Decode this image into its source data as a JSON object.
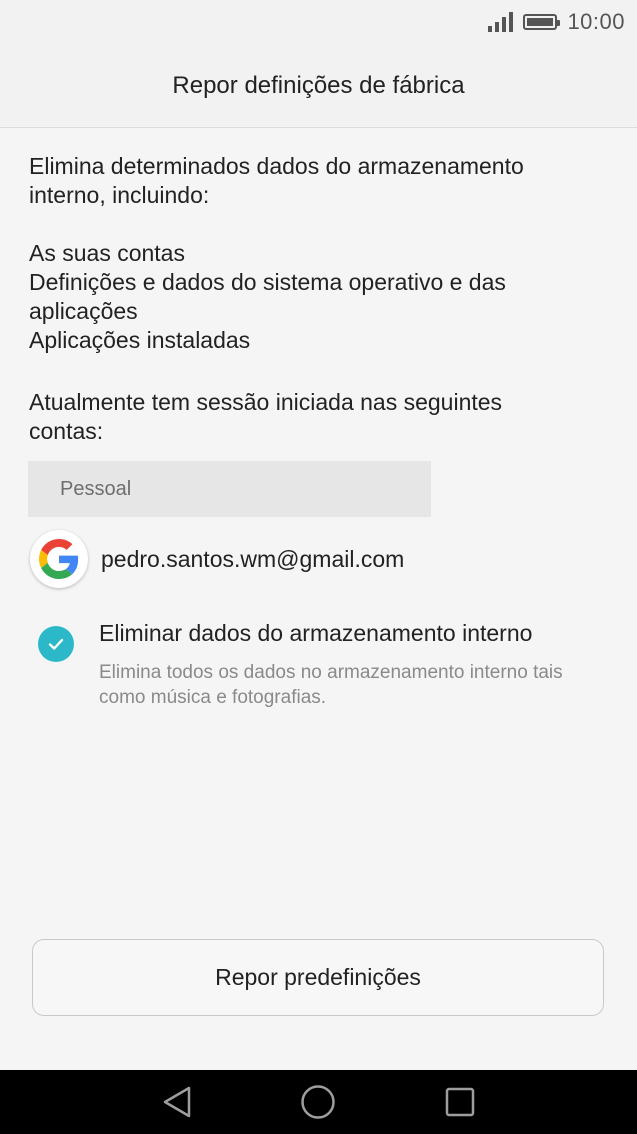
{
  "status_bar": {
    "time": "10:00",
    "icons": [
      "signal-icon",
      "battery-icon"
    ]
  },
  "header": {
    "title": "Repor definições de fábrica"
  },
  "content": {
    "intro_line1": "Elimina determinados dados do armazenamento",
    "intro_line2": "interno, incluindo:",
    "items": [
      "As suas contas",
      "Definições e dados do sistema operativo e das",
      "aplicações",
      "Aplicações instaladas"
    ],
    "accounts_line1": "Atualmente tem sessão iniciada nas seguintes",
    "accounts_line2": "contas:"
  },
  "accounts": {
    "section_label": "Pessoal",
    "email": "pedro.santos.wm@gmail.com"
  },
  "option": {
    "title": "Eliminar dados do armazenamento interno",
    "description": "Elimina todos os dados no armazenamento interno tais como música e fotografias.",
    "checked": true,
    "accent_color": "#2bb8c9"
  },
  "button": {
    "label": "Repor predefinições"
  },
  "navigation": {
    "icons": [
      "back-icon",
      "home-icon",
      "recents-icon"
    ]
  }
}
